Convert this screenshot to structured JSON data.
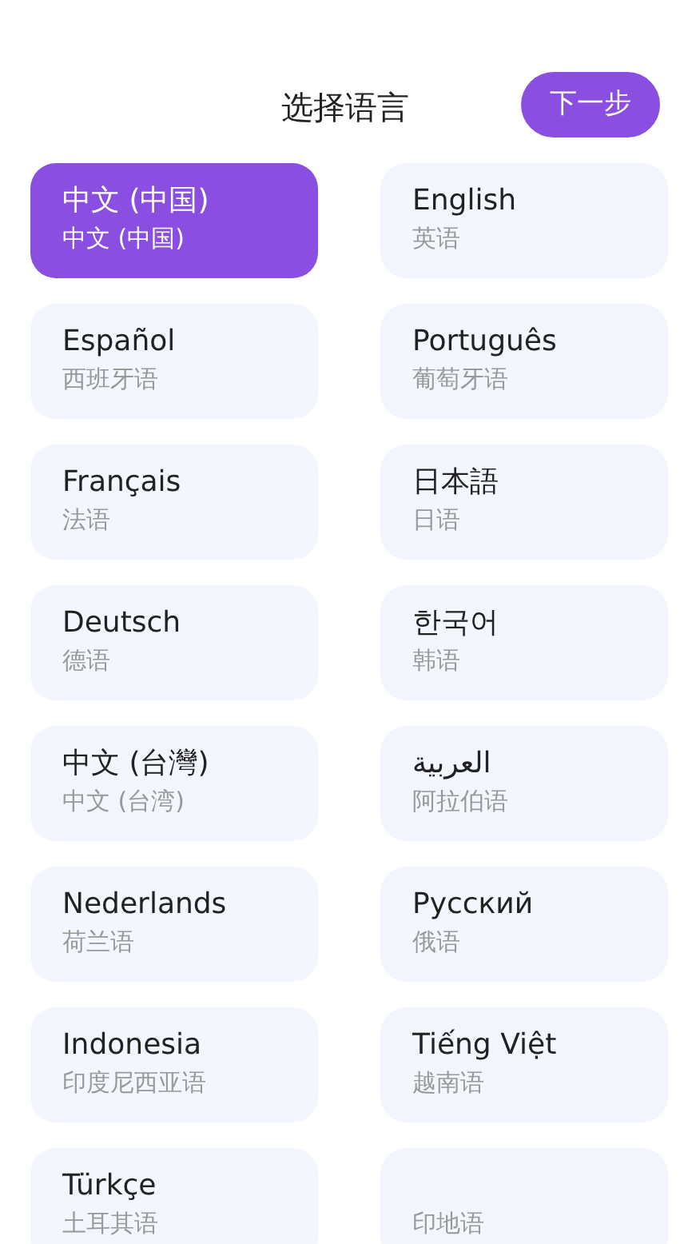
{
  "title": "选择语言",
  "next_button": "下一步",
  "languages": [
    {
      "name": "中文 (中国)",
      "translation": "中文 (中国)",
      "selected": true
    },
    {
      "name": "English",
      "translation": "英语",
      "selected": false
    },
    {
      "name": "Español",
      "translation": "西班牙语",
      "selected": false
    },
    {
      "name": "Português",
      "translation": "葡萄牙语",
      "selected": false
    },
    {
      "name": "Français",
      "translation": "法语",
      "selected": false
    },
    {
      "name": "日本語",
      "translation": "日语",
      "selected": false
    },
    {
      "name": "Deutsch",
      "translation": "德语",
      "selected": false
    },
    {
      "name": "한국어",
      "translation": "韩语",
      "selected": false
    },
    {
      "name": "中文 (台灣)",
      "translation": "中文 (台湾)",
      "selected": false
    },
    {
      "name": "العربية",
      "translation": "阿拉伯语",
      "selected": false
    },
    {
      "name": "Nederlands",
      "translation": "荷兰语",
      "selected": false
    },
    {
      "name": "Русский",
      "translation": "俄语",
      "selected": false
    },
    {
      "name": "Indonesia",
      "translation": "印度尼西亚语",
      "selected": false
    },
    {
      "name": "Tiếng Việt",
      "translation": "越南语",
      "selected": false
    },
    {
      "name": "Türkçe",
      "translation": "土耳其语",
      "selected": false
    },
    {
      "translation": "印地语",
      "selected": false
    }
  ]
}
